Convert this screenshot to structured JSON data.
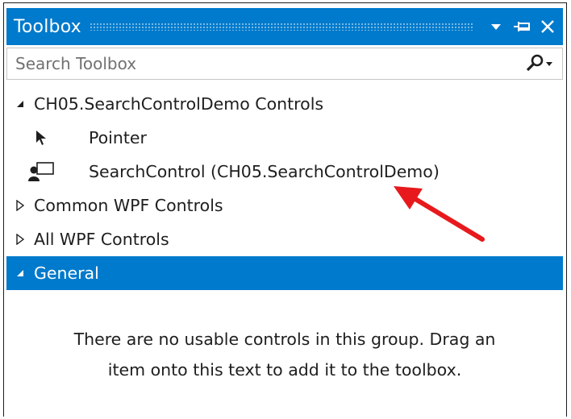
{
  "window": {
    "title": "Toolbox"
  },
  "search": {
    "placeholder": "Search Toolbox"
  },
  "groups": [
    {
      "label": "CH05.SearchControlDemo Controls",
      "expanded": true,
      "items": [
        {
          "label": "Pointer",
          "icon": "pointer-icon"
        },
        {
          "label": "SearchControl (CH05.SearchControlDemo)",
          "icon": "user-control-icon"
        }
      ]
    },
    {
      "label": "Common WPF Controls",
      "expanded": false
    },
    {
      "label": "All WPF Controls",
      "expanded": false
    },
    {
      "label": "General",
      "expanded": true,
      "selected": true,
      "empty_message_line1": "There are no usable controls in this group. Drag an",
      "empty_message_line2": "item onto this text to add it to the toolbox."
    }
  ],
  "colors": {
    "accent": "#007acc",
    "annotation_arrow": "#e8191c"
  }
}
